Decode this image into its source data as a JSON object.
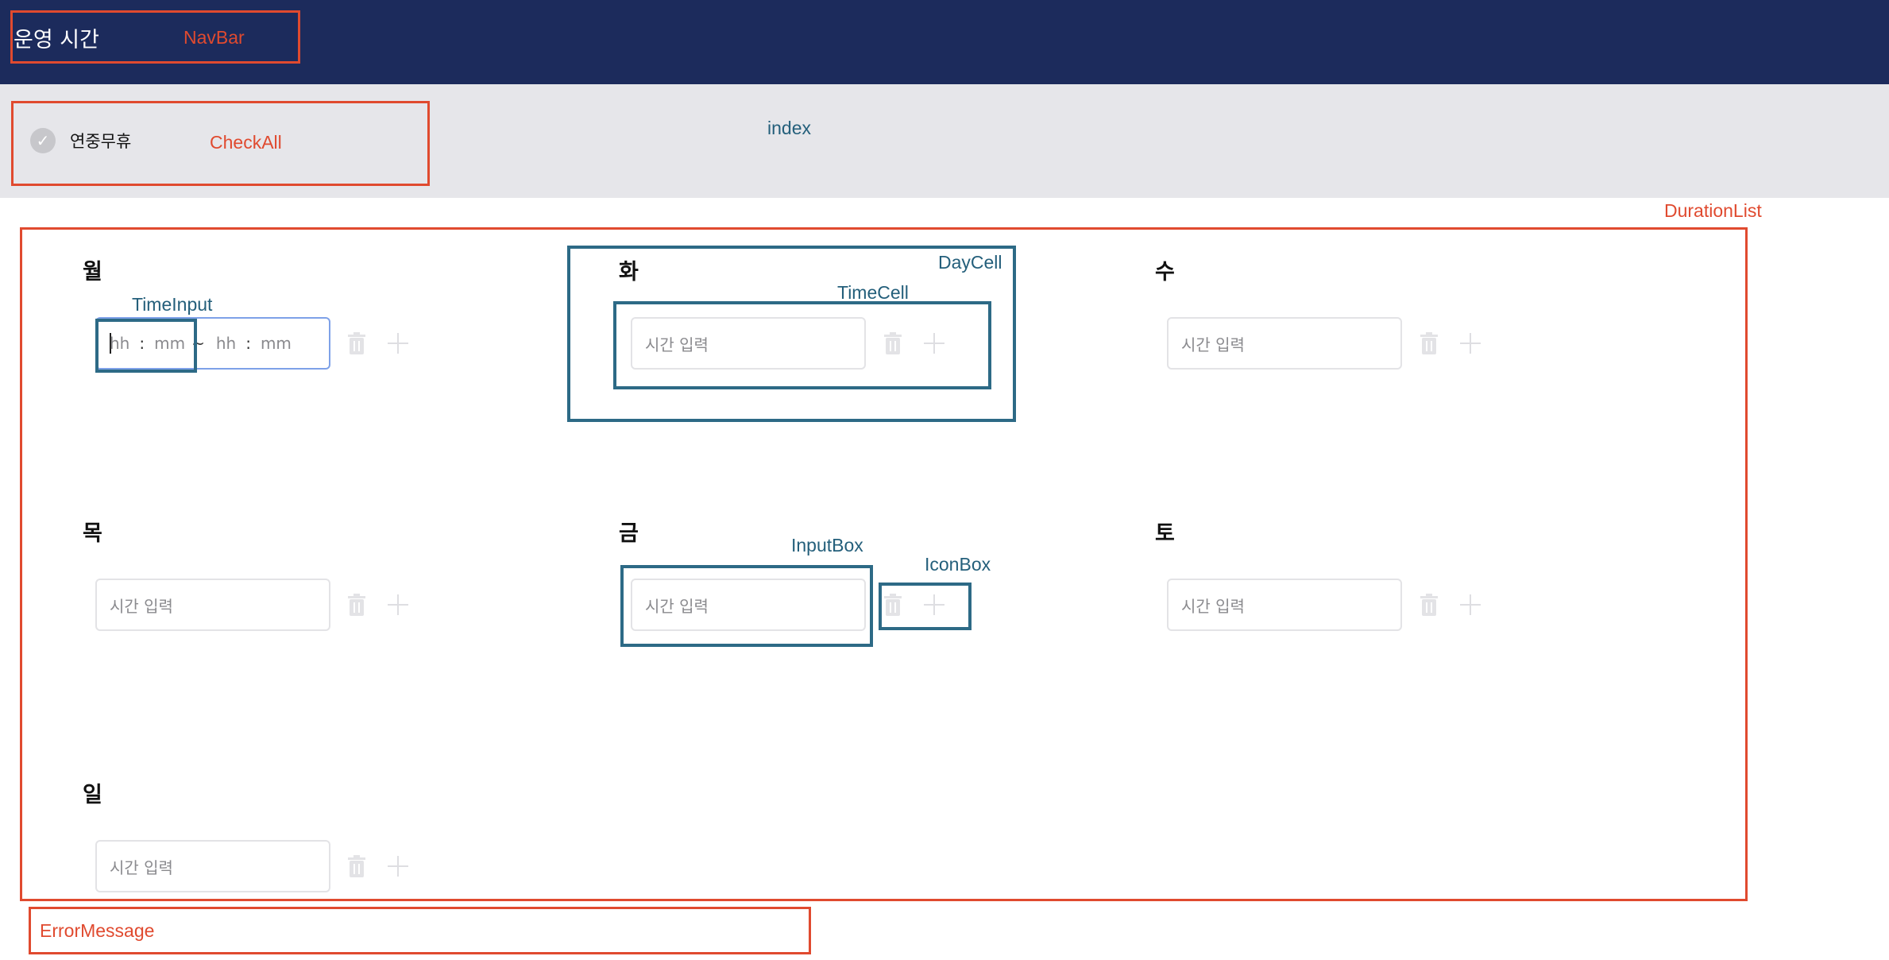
{
  "navbar": {
    "title": "운영 시간"
  },
  "check_all": {
    "label": "연중무휴",
    "icon": "check-icon"
  },
  "placeholder": "시간 입력",
  "time_input": {
    "hour_placeholder": "hh",
    "minute_placeholder": "mm",
    "separator": ":",
    "range_separator": "~"
  },
  "days": [
    {
      "label": "월"
    },
    {
      "label": "화"
    },
    {
      "label": "수"
    },
    {
      "label": "목"
    },
    {
      "label": "금"
    },
    {
      "label": "토"
    },
    {
      "label": "일"
    }
  ],
  "annotations": {
    "navbar": "NavBar",
    "check_all": "CheckAll",
    "index": "index",
    "duration_list": "DurationList",
    "day_cell": "DayCell",
    "time_cell": "TimeCell",
    "time_input": "TimeInput",
    "input_box": "InputBox",
    "icon_box": "IconBox",
    "error_message": "ErrorMessage"
  },
  "colors": {
    "navbar_bg": "#1c2b5c",
    "check_bar_bg": "#e6e6ea",
    "annotation_red": "#e04a2f",
    "annotation_blue": "#2d6a86",
    "active_input_border": "#7ea1e8"
  }
}
